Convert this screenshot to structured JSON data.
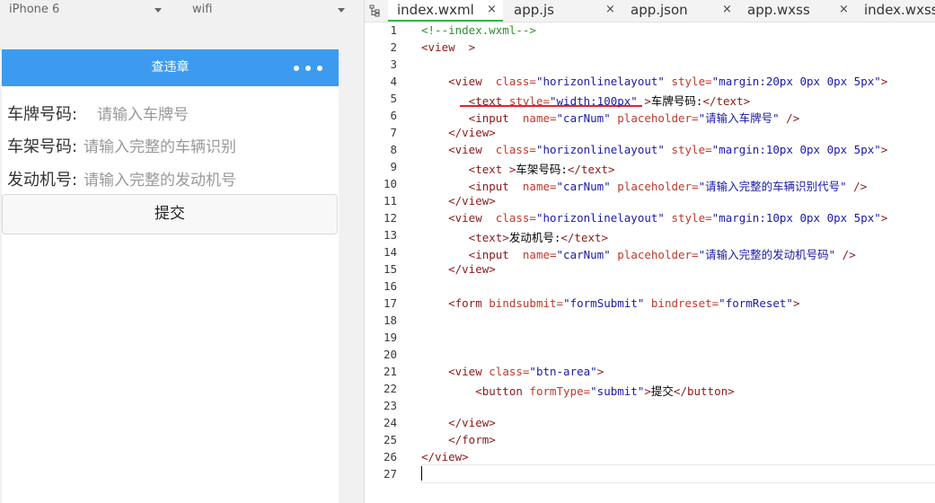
{
  "simulator": {
    "device": "iPhone 6",
    "network": "wifi",
    "nav_title": "查违章",
    "form": {
      "rows": [
        {
          "label": "车牌号码:",
          "placeholder": "请输入车牌号"
        },
        {
          "label": "车架号码:",
          "placeholder": "请输入完整的车辆识别"
        },
        {
          "label": "发动机号:",
          "placeholder": "请输入完整的发动机号"
        }
      ],
      "submit_label": "提交"
    }
  },
  "editor": {
    "tabs": [
      {
        "label": "index.wxml",
        "close": "×",
        "active": true
      },
      {
        "label": "app.js",
        "close": "×",
        "active": false
      },
      {
        "label": "app.json",
        "close": "×",
        "active": false
      },
      {
        "label": "app.wxss",
        "close": "×",
        "active": false
      },
      {
        "label": "index.wxss",
        "close": "",
        "active": false
      }
    ],
    "line_numbers": [
      "1",
      "2",
      "3",
      "4",
      "5",
      "6",
      "7",
      "8",
      "9",
      "10",
      "11",
      "12",
      "13",
      "14",
      "15",
      "16",
      "17",
      "18",
      "19",
      "20",
      "21",
      "22",
      "23",
      "24",
      "25",
      "26",
      "27"
    ],
    "lines": [
      [
        {
          "c": "cm",
          "t": "<!--index.wxml-->"
        }
      ],
      [
        {
          "c": "tg",
          "t": "<view  >"
        }
      ],
      [],
      [
        {
          "c": "tg",
          "t": "    <view  "
        },
        {
          "c": "at",
          "t": "class="
        },
        {
          "c": "st",
          "t": "\"horizonlinelayout\""
        },
        {
          "c": "at",
          "t": " style="
        },
        {
          "c": "st",
          "t": "\"margin:20px 0px 0px 5px\""
        },
        {
          "c": "tg",
          "t": ">"
        }
      ],
      [
        {
          "c": "tg",
          "t": "       <text "
        },
        {
          "c": "at",
          "t": "style="
        },
        {
          "c": "st",
          "t": "\"width:100px\""
        },
        {
          "c": "tg",
          "t": " >"
        },
        {
          "c": "tx",
          "t": "车牌号码:"
        },
        {
          "c": "tg",
          "t": "</text>"
        }
      ],
      [
        {
          "c": "tg",
          "t": "       <input  "
        },
        {
          "c": "at",
          "t": "name="
        },
        {
          "c": "st",
          "t": "\"carNum\""
        },
        {
          "c": "at",
          "t": " placeholder="
        },
        {
          "c": "st",
          "t": "\"请输入车牌号\""
        },
        {
          "c": "tg",
          "t": " />"
        }
      ],
      [
        {
          "c": "tg",
          "t": "    </view>"
        }
      ],
      [
        {
          "c": "tg",
          "t": "    <view  "
        },
        {
          "c": "at",
          "t": "class="
        },
        {
          "c": "st",
          "t": "\"horizonlinelayout\""
        },
        {
          "c": "at",
          "t": " style="
        },
        {
          "c": "st",
          "t": "\"margin:10px 0px 0px 5px\""
        },
        {
          "c": "tg",
          "t": ">"
        }
      ],
      [
        {
          "c": "tg",
          "t": "       <text >"
        },
        {
          "c": "tx",
          "t": "车架号码:"
        },
        {
          "c": "tg",
          "t": "</text>"
        }
      ],
      [
        {
          "c": "tg",
          "t": "       <input  "
        },
        {
          "c": "at",
          "t": "name="
        },
        {
          "c": "st",
          "t": "\"carNum\""
        },
        {
          "c": "at",
          "t": " placeholder="
        },
        {
          "c": "st",
          "t": "\"请输入完整的车辆识别代号\""
        },
        {
          "c": "tg",
          "t": " />"
        }
      ],
      [
        {
          "c": "tg",
          "t": "    </view>"
        }
      ],
      [
        {
          "c": "tg",
          "t": "    <view  "
        },
        {
          "c": "at",
          "t": "class="
        },
        {
          "c": "st",
          "t": "\"horizonlinelayout\""
        },
        {
          "c": "at",
          "t": " style="
        },
        {
          "c": "st",
          "t": "\"margin:10px 0px 0px 5px\""
        },
        {
          "c": "tg",
          "t": ">"
        }
      ],
      [
        {
          "c": "tg",
          "t": "       <text>"
        },
        {
          "c": "tx",
          "t": "发动机号:"
        },
        {
          "c": "tg",
          "t": "</text>"
        }
      ],
      [
        {
          "c": "tg",
          "t": "       <input  "
        },
        {
          "c": "at",
          "t": "name="
        },
        {
          "c": "st",
          "t": "\"carNum\""
        },
        {
          "c": "at",
          "t": " placeholder="
        },
        {
          "c": "st",
          "t": "\"请输入完整的发动机号码\""
        },
        {
          "c": "tg",
          "t": " />"
        }
      ],
      [
        {
          "c": "tg",
          "t": "    </view>"
        }
      ],
      [],
      [
        {
          "c": "tg",
          "t": "    <form "
        },
        {
          "c": "at",
          "t": "bindsubmit="
        },
        {
          "c": "st",
          "t": "\"formSubmit\""
        },
        {
          "c": "at",
          "t": " bindreset="
        },
        {
          "c": "st",
          "t": "\"formReset\""
        },
        {
          "c": "tg",
          "t": ">"
        }
      ],
      [],
      [],
      [],
      [
        {
          "c": "tg",
          "t": "    <view "
        },
        {
          "c": "at",
          "t": "class="
        },
        {
          "c": "st",
          "t": "\"btn-area\""
        },
        {
          "c": "tg",
          "t": ">"
        }
      ],
      [
        {
          "c": "tg",
          "t": "        <button "
        },
        {
          "c": "at",
          "t": "formType="
        },
        {
          "c": "st",
          "t": "\"submit\""
        },
        {
          "c": "tg",
          "t": ">"
        },
        {
          "c": "tx",
          "t": "提交"
        },
        {
          "c": "tg",
          "t": "</button>"
        }
      ],
      [],
      [
        {
          "c": "tg",
          "t": "    </view>"
        }
      ],
      [
        {
          "c": "tg",
          "t": "    </form>"
        }
      ],
      [
        {
          "c": "tg",
          "t": "</view>"
        }
      ],
      []
    ]
  },
  "colors": {
    "navbar": "#3d9bef",
    "active_tab_underline": "#3bb54a",
    "annotation_underline": "#e0262b"
  }
}
